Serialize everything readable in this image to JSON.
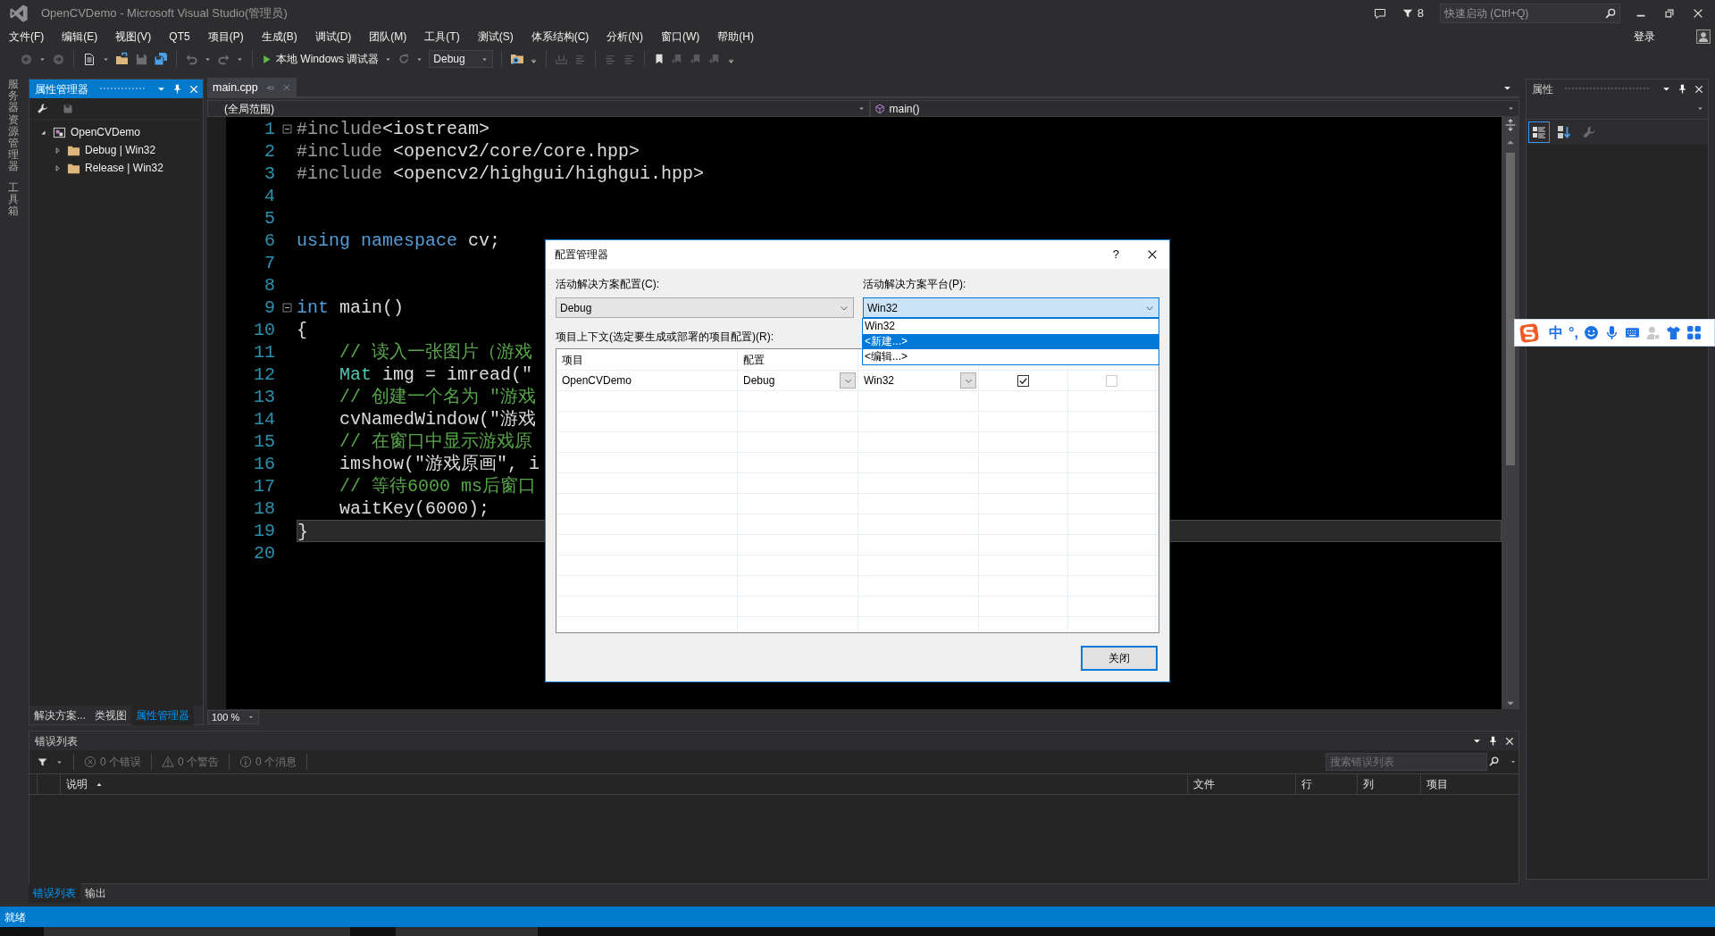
{
  "window": {
    "title": "OpenCVDemo - Microsoft Visual Studio(管理员)",
    "notifications": "8",
    "quick_launch": {
      "placeholder": "快速启动 (Ctrl+Q)"
    }
  },
  "menu": [
    "文件(F)",
    "编辑(E)",
    "视图(V)",
    "QT5",
    "项目(P)",
    "生成(B)",
    "调试(D)",
    "团队(M)",
    "工具(T)",
    "测试(S)",
    "体系结构(C)",
    "分析(N)",
    "窗口(W)",
    "帮助(H)"
  ],
  "account": "登录",
  "toolbar": {
    "debugger": "本地 Windows 调试器",
    "configuration": "Debug"
  },
  "side_tabs": [
    "服务器资源管理器",
    "工具箱"
  ],
  "property_manager": {
    "title": "属性管理器",
    "tree": [
      {
        "label": "OpenCVDemo",
        "kind": "project",
        "expanded": true,
        "children": [
          {
            "label": "Debug | Win32",
            "kind": "folder",
            "expanded": false
          },
          {
            "label": "Release | Win32",
            "kind": "folder",
            "expanded": false
          }
        ]
      }
    ],
    "tabs": [
      {
        "label": "解决方案...",
        "selected": false
      },
      {
        "label": "类视图",
        "selected": false
      },
      {
        "label": "属性管理器",
        "selected": true
      }
    ]
  },
  "editor": {
    "tabs": [
      {
        "label": "main.cpp",
        "selected": true
      }
    ],
    "scope": "(全局范围)",
    "member": "main()",
    "zoom": "100 %",
    "lines": [
      {
        "number": "1",
        "foldable": true,
        "current": false,
        "tokens": [
          {
            "text": "#include",
            "kind": "preprocessor"
          },
          {
            "text": "<iostream>",
            "kind": "plain"
          }
        ]
      },
      {
        "number": "2",
        "foldable": false,
        "current": false,
        "tokens": [
          {
            "text": "#include",
            "kind": "preprocessor"
          },
          {
            "text": " <opencv2/core/core.hpp>",
            "kind": "plain"
          }
        ]
      },
      {
        "number": "3",
        "foldable": false,
        "current": false,
        "tokens": [
          {
            "text": "#include",
            "kind": "preprocessor"
          },
          {
            "text": " <opencv2/highgui/highgui.hpp>",
            "kind": "plain"
          }
        ]
      },
      {
        "number": "4",
        "foldable": false,
        "current": false
      },
      {
        "number": "5",
        "foldable": false,
        "current": false
      },
      {
        "number": "6",
        "foldable": false,
        "current": false,
        "tokens": [
          {
            "text": "using namespace",
            "kind": "keyword"
          },
          {
            "text": " cv;",
            "kind": "plain"
          }
        ]
      },
      {
        "number": "7",
        "foldable": false,
        "current": false
      },
      {
        "number": "8",
        "foldable": false,
        "current": false
      },
      {
        "number": "9",
        "foldable": true,
        "current": false,
        "tokens": [
          {
            "text": "int",
            "kind": "keyword"
          },
          {
            "text": " main()",
            "kind": "plain"
          }
        ]
      },
      {
        "number": "10",
        "foldable": false,
        "current": false,
        "tokens": [
          {
            "text": "{",
            "kind": "plain"
          }
        ]
      },
      {
        "number": "11",
        "foldable": false,
        "current": false,
        "tokens": [
          {
            "text": "    // 读入一张图片（游戏",
            "kind": "comment"
          }
        ]
      },
      {
        "number": "12",
        "foldable": false,
        "current": false,
        "tokens": [
          {
            "text": "    Mat",
            "kind": "type"
          },
          {
            "text": " img = imread(\"",
            "kind": "plain"
          }
        ]
      },
      {
        "number": "13",
        "foldable": false,
        "current": false,
        "tokens": [
          {
            "text": "    // 创建一个名为 \"游戏",
            "kind": "comment"
          }
        ]
      },
      {
        "number": "14",
        "foldable": false,
        "current": false,
        "tokens": [
          {
            "text": "    cvNamedWindow(\"游戏",
            "kind": "plain"
          }
        ]
      },
      {
        "number": "15",
        "foldable": false,
        "current": false,
        "tokens": [
          {
            "text": "    // 在窗口中显示游戏原",
            "kind": "comment"
          }
        ]
      },
      {
        "number": "16",
        "foldable": false,
        "current": false,
        "tokens": [
          {
            "text": "    imshow(\"游戏原画\", i",
            "kind": "plain"
          }
        ]
      },
      {
        "number": "17",
        "foldable": false,
        "current": false,
        "tokens": [
          {
            "text": "    // 等待6000 ms后窗口",
            "kind": "comment"
          }
        ]
      },
      {
        "number": "18",
        "foldable": false,
        "current": false,
        "tokens": [
          {
            "text": "    waitKey(6000);",
            "kind": "plain"
          }
        ]
      },
      {
        "number": "19",
        "foldable": false,
        "current": true,
        "tokens": [
          {
            "text": "}",
            "kind": "plain"
          }
        ]
      },
      {
        "number": "20",
        "foldable": false,
        "current": false
      }
    ]
  },
  "properties": {
    "title": "属性",
    "views": [
      {
        "kind": "categorized",
        "selected": true
      },
      {
        "kind": "alphabetical",
        "selected": false
      },
      {
        "kind": "pages",
        "selected": false
      }
    ]
  },
  "error_list": {
    "title": "错误列表",
    "counts": [
      {
        "text": "0 个错误",
        "kind": "error"
      },
      {
        "text": "0 个警告",
        "kind": "warning"
      },
      {
        "text": "0 个消息",
        "kind": "message"
      }
    ],
    "search": {
      "placeholder": "搜索错误列表"
    },
    "columns": [
      {
        "label": "说明",
        "sorted": true
      },
      {
        "label": "文件",
        "sorted": false
      },
      {
        "label": "行",
        "sorted": false
      },
      {
        "label": "列",
        "sorted": false
      },
      {
        "label": "项目",
        "sorted": false
      }
    ]
  },
  "bottom_tabs": [
    {
      "label": "错误列表",
      "selected": true
    },
    {
      "label": "输出",
      "selected": false
    }
  ],
  "status_bar": "就绪",
  "dialog": {
    "title": "配置管理器",
    "help": "?",
    "config_label": "活动解决方案配置(C):",
    "config_value": "Debug",
    "platform_label": "活动解决方案平台(P):",
    "platform_value": "Win32",
    "platform_expanded": true,
    "platform_options": [
      {
        "label": "Win32",
        "selected": false
      },
      {
        "label": "<新建...>",
        "selected": true
      },
      {
        "label": "<编辑...>",
        "selected": false
      }
    ],
    "grid_label": "项目上下文(选定要生成或部署的项目配置)(R):",
    "columns": [
      "项目",
      "配置"
    ],
    "rows": [
      {
        "project": "OpenCVDemo",
        "configuration": "Debug",
        "platform": "Win32",
        "build": true,
        "deploy": false
      }
    ],
    "close_button": "关闭"
  },
  "ime_bar": {
    "mode": "中",
    "punctuation": "°,"
  }
}
